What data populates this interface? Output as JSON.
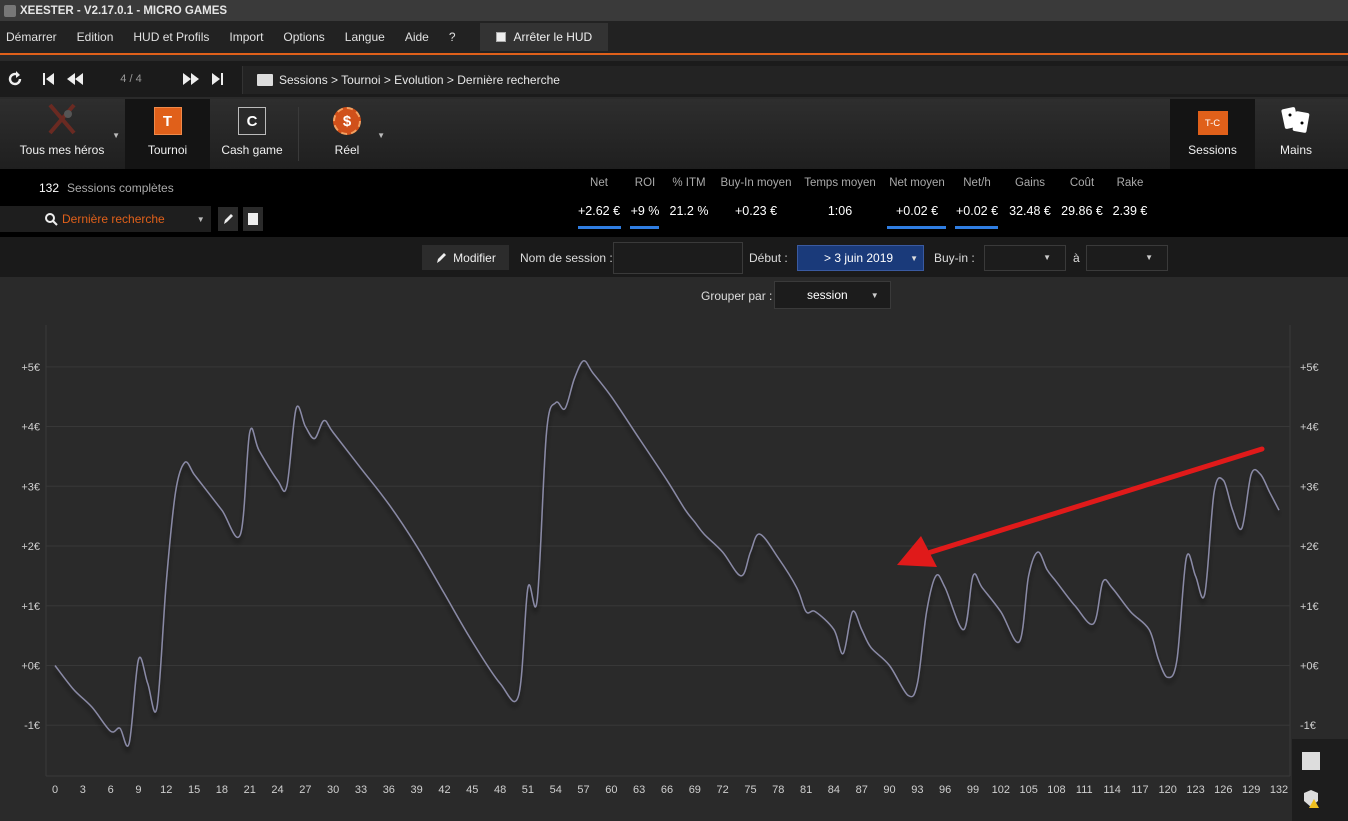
{
  "titlebar": {
    "title": "XEESTER - V2.17.0.1 - MICRO GAMES"
  },
  "menu": {
    "items": [
      "Démarrer",
      "Edition",
      "HUD et Profils",
      "Import",
      "Options",
      "Langue",
      "Aide",
      "?"
    ],
    "hud_button": "Arrêter le HUD"
  },
  "nav": {
    "counter": "4 / 4",
    "breadcrumb": "Sessions > Tournoi > Evolution > Dernière recherche"
  },
  "toolbar": {
    "heroes": "Tous mes héros",
    "tournament": "Tournoi",
    "tournament_glyph": "T",
    "cashgame": "Cash game",
    "cashgame_glyph": "C",
    "real": "Réel",
    "real_glyph": "$",
    "sessions": "Sessions",
    "sessions_glyph": "T-C",
    "hands": "Mains"
  },
  "summary": {
    "count": "132",
    "label": "Sessions complètes",
    "search": "Dernière recherche"
  },
  "stats": {
    "headers": [
      "Net",
      "ROI",
      "% ITM",
      "Buy-In moyen",
      "Temps moyen",
      "Net moyen",
      "Net/h",
      "Gains",
      "Coût",
      "Rake"
    ],
    "values": [
      "+2.62 €",
      "+9 %",
      "21.2 %",
      "+0.23 €",
      "1:06",
      "+0.02 €",
      "+0.02 €",
      "32.48 €",
      "29.86 €",
      "2.39 €"
    ]
  },
  "filters": {
    "modify": "Modifier",
    "session_name_label": "Nom de session :",
    "session_name_value": "",
    "start_label": "Début :",
    "start_value": "> 3 juin 2019",
    "buyin_label": "Buy-in :",
    "to_label": "à",
    "group_label": "Grouper par :",
    "group_value": "session"
  },
  "colors": {
    "accent": "#e0601a",
    "selected": "#1a3a7a",
    "stat_bar": "#2f7de1",
    "arrow": "#e01a1a"
  },
  "chart_data": {
    "type": "line",
    "ylabel_ticks": [
      "+5€",
      "+4€",
      "+3€",
      "+2€",
      "+1€",
      "+0€",
      "-1€"
    ],
    "y_ticks": [
      5,
      4,
      3,
      2,
      1,
      0,
      -1
    ],
    "ylim": [
      -1.85,
      5.7
    ],
    "xlim": [
      0,
      132
    ],
    "x_ticks": [
      0,
      3,
      6,
      9,
      12,
      15,
      18,
      21,
      24,
      27,
      30,
      33,
      36,
      39,
      42,
      45,
      48,
      51,
      54,
      57,
      60,
      63,
      66,
      69,
      72,
      75,
      78,
      81,
      84,
      87,
      90,
      93,
      96,
      99,
      102,
      105,
      108,
      111,
      114,
      117,
      120,
      123,
      126,
      129,
      132
    ],
    "grid": true,
    "series": [
      {
        "x": [
          0,
          2,
          4,
          6,
          7,
          8,
          9,
          10,
          11,
          12,
          13,
          14,
          15,
          16,
          18,
          20,
          21,
          22,
          24,
          25,
          26,
          27,
          28,
          29,
          30,
          33,
          36,
          39,
          42,
          45,
          48,
          50,
          51,
          52,
          53,
          54,
          55,
          56,
          57,
          58,
          60,
          63,
          66,
          68,
          69,
          70,
          72,
          74,
          75,
          76,
          78,
          80,
          81,
          82,
          84,
          85,
          86,
          87,
          88,
          90,
          92,
          93,
          94,
          95,
          96,
          98,
          99,
          100,
          102,
          104,
          105,
          106,
          107,
          108,
          110,
          112,
          113,
          114,
          116,
          118,
          119,
          120,
          121,
          122,
          123,
          124,
          125,
          126,
          127,
          128,
          129,
          130,
          131,
          132
        ],
        "values": [
          0.0,
          -0.4,
          -0.7,
          -1.1,
          -1.05,
          -1.3,
          0.1,
          -0.3,
          -0.7,
          1.4,
          2.9,
          3.4,
          3.2,
          3.0,
          2.6,
          2.2,
          3.9,
          3.6,
          3.1,
          3.0,
          4.3,
          4.0,
          3.8,
          4.1,
          3.9,
          3.3,
          2.7,
          2.0,
          1.2,
          0.4,
          -0.3,
          -0.5,
          1.3,
          1.1,
          3.9,
          4.4,
          4.3,
          4.8,
          5.1,
          4.9,
          4.5,
          3.8,
          3.1,
          2.6,
          2.4,
          2.2,
          1.9,
          1.5,
          1.9,
          2.2,
          1.8,
          1.3,
          0.9,
          0.9,
          0.6,
          0.2,
          0.9,
          0.6,
          0.3,
          0.0,
          -0.5,
          -0.3,
          0.9,
          1.5,
          1.3,
          0.6,
          1.5,
          1.3,
          0.9,
          0.4,
          1.5,
          1.9,
          1.6,
          1.4,
          1.0,
          0.7,
          1.4,
          1.3,
          0.9,
          0.6,
          0.1,
          -0.2,
          0.1,
          1.8,
          1.5,
          1.2,
          2.9,
          3.1,
          2.6,
          2.3,
          3.2,
          3.2,
          2.9,
          2.6
        ]
      }
    ]
  }
}
